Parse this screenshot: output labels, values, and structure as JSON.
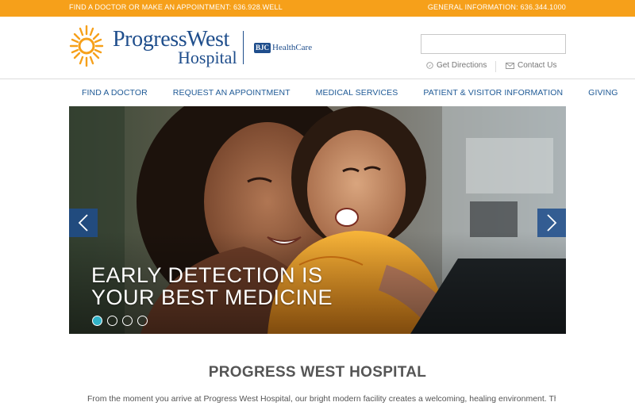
{
  "topbar": {
    "left_text": "FIND A DOCTOR OR MAKE AN APPOINTMENT: 636.928.WELL",
    "right_text": "GENERAL INFORMATION: 636.344.1000",
    "color": "#f6a01a"
  },
  "logo": {
    "name_line1": "ProgressWest",
    "name_line2": "Hospital",
    "partner_badge": "BJC",
    "partner_text": "HealthCare",
    "sun_color": "#f6a01a",
    "brand_color": "#1f4e8c"
  },
  "search": {
    "value": "",
    "placeholder": ""
  },
  "utility": {
    "directions_label": "Get Directions",
    "directions_icon": "compass-icon",
    "contact_label": "Contact Us",
    "contact_icon": "envelope-icon"
  },
  "nav": {
    "items": [
      {
        "label": "FIND A DOCTOR"
      },
      {
        "label": "REQUEST AN APPOINTMENT"
      },
      {
        "label": "MEDICAL SERVICES"
      },
      {
        "label": "PATIENT & VISITOR INFORMATION"
      },
      {
        "label": "GIVING"
      }
    ]
  },
  "hero": {
    "caption_line1": "EARLY DETECTION IS",
    "caption_line2": "YOUR BEST MEDICINE",
    "prev_icon": "chevron-left-icon",
    "next_icon": "chevron-right-icon",
    "slide_count": 4,
    "active_slide": 1,
    "active_dot_color": "#31b3c8"
  },
  "main": {
    "title": "PROGRESS WEST HOSPITAL",
    "intro": "From the moment you arrive at Progress West Hospital, our bright modern facility creates a welcoming, healing environment. This"
  }
}
